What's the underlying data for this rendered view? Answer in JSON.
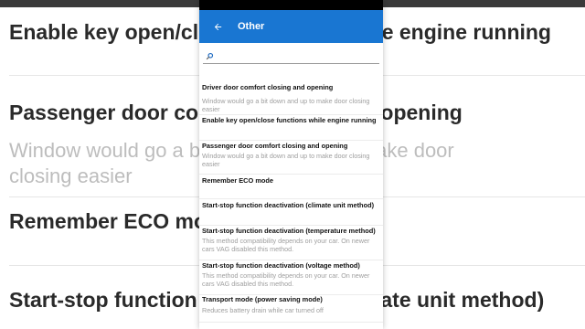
{
  "background": {
    "lines": [
      {
        "kind": "title",
        "text": "Enable key open/close functions while engine running"
      },
      {
        "kind": "title",
        "text": "Passenger door comfort closing and opening"
      },
      {
        "kind": "sub",
        "text": "Window would go a bit down and up to make door"
      },
      {
        "kind": "sub",
        "text": "closing easier"
      },
      {
        "kind": "title",
        "text": "Remember ECO mode"
      },
      {
        "kind": "title",
        "text": "Start-stop function deactivation (climate unit method)"
      }
    ]
  },
  "appbar": {
    "title": "Other",
    "color": "#1976d2"
  },
  "search": {
    "placeholder": "",
    "value": ""
  },
  "items": [
    {
      "title": "Driver door comfort closing and opening",
      "subtitle": "Window would go a bit down and up to make door closing easier"
    },
    {
      "title": "Enable key open/close functions while engine running",
      "subtitle": ""
    },
    {
      "title": "Passenger door comfort closing and opening",
      "subtitle": "Window would go a bit down and up to make door closing easier"
    },
    {
      "title": "Remember ECO mode",
      "subtitle": ""
    },
    {
      "title": "Start-stop function deactivation (climate unit method)",
      "subtitle": ""
    },
    {
      "title": "Start-stop function deactivation (temperature method)",
      "subtitle": "This method compatibility depends on your car. On newer cars VAG disabled this method."
    },
    {
      "title": "Start-stop function deactivation (voltage method)",
      "subtitle": "This method compatibility depends on your car. On newer cars VAG disabled this method."
    },
    {
      "title": "Transport mode (power saving mode)",
      "subtitle": "Reduces battery drain while car turned off"
    }
  ]
}
